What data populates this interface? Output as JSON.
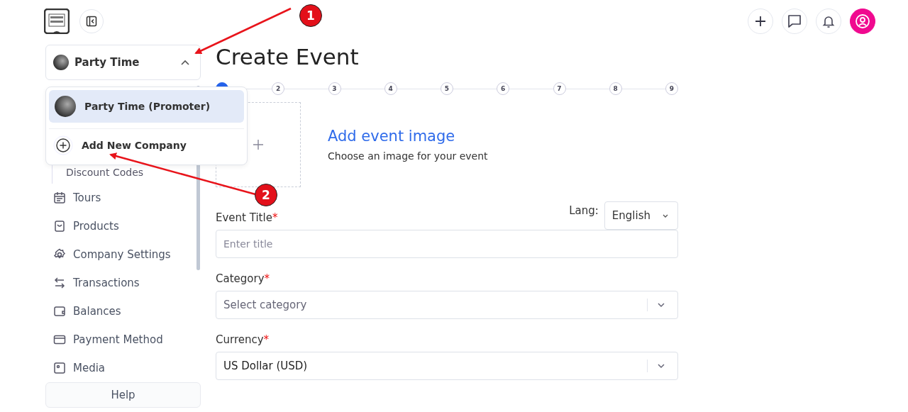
{
  "company_switcher": {
    "name": "Party Time",
    "expanded": true
  },
  "company_menu": [
    {
      "kind": "company",
      "label": "Party Time (Promoter)",
      "selected": true
    },
    {
      "kind": "add",
      "label": "Add New Company",
      "selected": false
    }
  ],
  "sidebar": {
    "items": [
      {
        "kind": "sub",
        "label": "Discount Codes"
      },
      {
        "kind": "item",
        "label": "Tours"
      },
      {
        "kind": "item",
        "label": "Products"
      },
      {
        "kind": "item",
        "label": "Company Settings"
      },
      {
        "kind": "item",
        "label": "Transactions"
      },
      {
        "kind": "item",
        "label": "Balances"
      },
      {
        "kind": "item",
        "label": "Payment Method"
      },
      {
        "kind": "item",
        "label": "Media"
      }
    ],
    "help": "Help"
  },
  "page_title": "Create Event",
  "steps": [
    {
      "selected": true
    },
    {
      "label": "2",
      "selected": false
    },
    {
      "label": "3",
      "selected": false
    },
    {
      "label": "4",
      "selected": false
    },
    {
      "label": "5",
      "selected": false
    },
    {
      "label": "6",
      "selected": false
    },
    {
      "label": "7",
      "selected": false
    },
    {
      "label": "8",
      "selected": false
    },
    {
      "label": "9",
      "selected": false
    }
  ],
  "image_upload": {
    "title": "Add event image",
    "subtitle": "Choose an image for your event"
  },
  "lang": {
    "label": "Lang:",
    "value": "English"
  },
  "fields": [
    {
      "kind": "input",
      "label": "Event Title",
      "required": "*",
      "placeholder": "Enter title"
    },
    {
      "kind": "select",
      "label": "Category",
      "required": "*",
      "placeholder": "Select category"
    },
    {
      "kind": "select",
      "label": "Currency",
      "required": "*",
      "value": "US Dollar (USD)"
    }
  ],
  "annotations": [
    {
      "label": "1"
    },
    {
      "label": "2"
    }
  ]
}
